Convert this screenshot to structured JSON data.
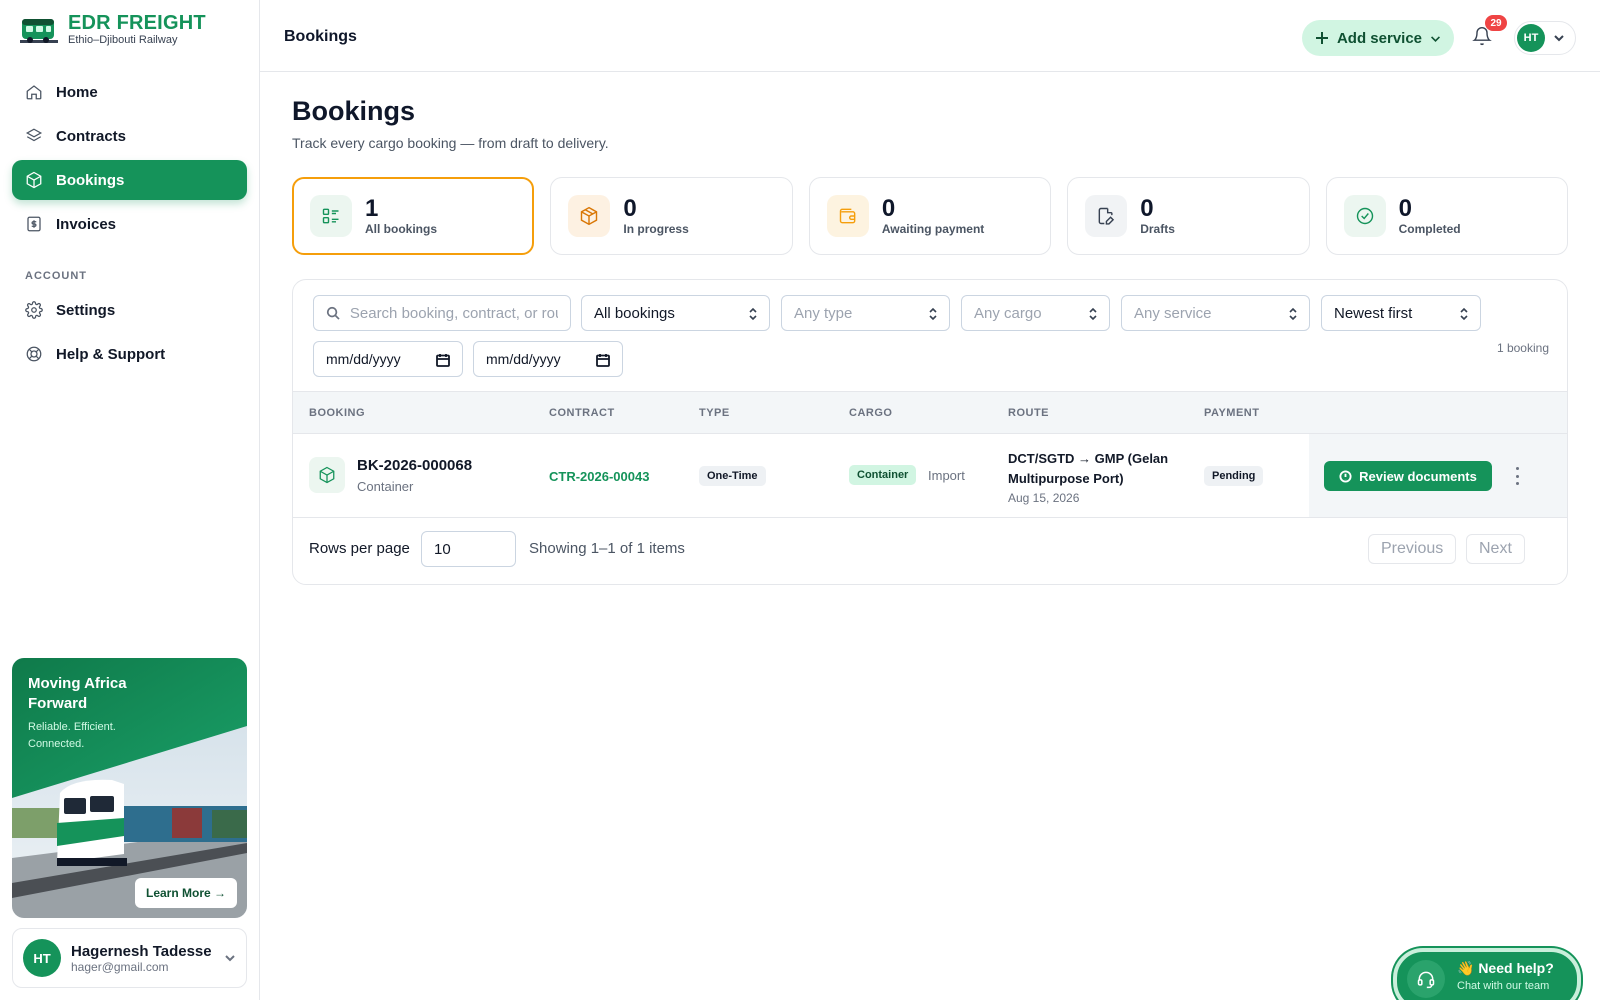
{
  "brand": {
    "title": "EDR FREIGHT",
    "subtitle": "Ethio–Djibouti Railway"
  },
  "sidebar": {
    "items": [
      {
        "label": "Home",
        "icon": "home-icon"
      },
      {
        "label": "Contracts",
        "icon": "layers-icon"
      },
      {
        "label": "Bookings",
        "icon": "package-icon",
        "active": true
      },
      {
        "label": "Invoices",
        "icon": "invoice-icon"
      }
    ],
    "account_heading": "ACCOUNT",
    "account_items": [
      {
        "label": "Settings",
        "icon": "gear-icon"
      },
      {
        "label": "Help & Support",
        "icon": "lifebuoy-icon"
      }
    ],
    "promo": {
      "title": "Moving Africa Forward",
      "subtitle": "Reliable. Efficient. Connected.",
      "cta": "Learn More →"
    },
    "user": {
      "initials": "HT",
      "name": "Hagernesh Tadesse",
      "email": "hager@gmail.com"
    }
  },
  "header": {
    "title": "Bookings",
    "add_service": "Add service",
    "notifications": "29",
    "initials": "HT"
  },
  "main": {
    "title": "Bookings",
    "subtitle": "Track every cargo booking — from draft to delivery.",
    "stats": [
      {
        "value": "1",
        "label": "All bookings",
        "active": true
      },
      {
        "value": "0",
        "label": "In progress"
      },
      {
        "value": "0",
        "label": "Awaiting payment"
      },
      {
        "value": "0",
        "label": "Drafts"
      },
      {
        "value": "0",
        "label": "Completed"
      }
    ],
    "filters": {
      "search_placeholder": "Search booking, contract, or route",
      "status": "All bookings",
      "type": "Any type",
      "cargo": "Any cargo",
      "service": "Any service",
      "sort": "Newest first",
      "date_from": "mm/dd/yyyy",
      "date_to": "mm/dd/yyyy",
      "count": "1 booking"
    },
    "columns": [
      "BOOKING",
      "CONTRACT",
      "TYPE",
      "CARGO",
      "ROUTE",
      "PAYMENT"
    ],
    "rows": [
      {
        "booking_id": "BK-2026-000068",
        "booking_sub": "Container",
        "contract": "CTR-2026-00043",
        "type": "One-Time",
        "cargo": "Container",
        "cargo_direction": "Import",
        "route": "DCT/SGTD → GMP (Gelan Multipurpose Port)",
        "route_date": "Aug 15, 2026",
        "payment": "Pending",
        "action": "Review documents"
      }
    ],
    "pager": {
      "rows_label": "Rows per page",
      "rows_value": "10",
      "showing": "Showing 1–1 of 1 items",
      "previous": "Previous",
      "next": "Next"
    }
  },
  "help": {
    "title": "👋 Need help?",
    "subtitle": "Chat with our team"
  },
  "colors": {
    "brand": "#15935a",
    "accent": "#f59e0b",
    "badge": "#ef4444"
  }
}
